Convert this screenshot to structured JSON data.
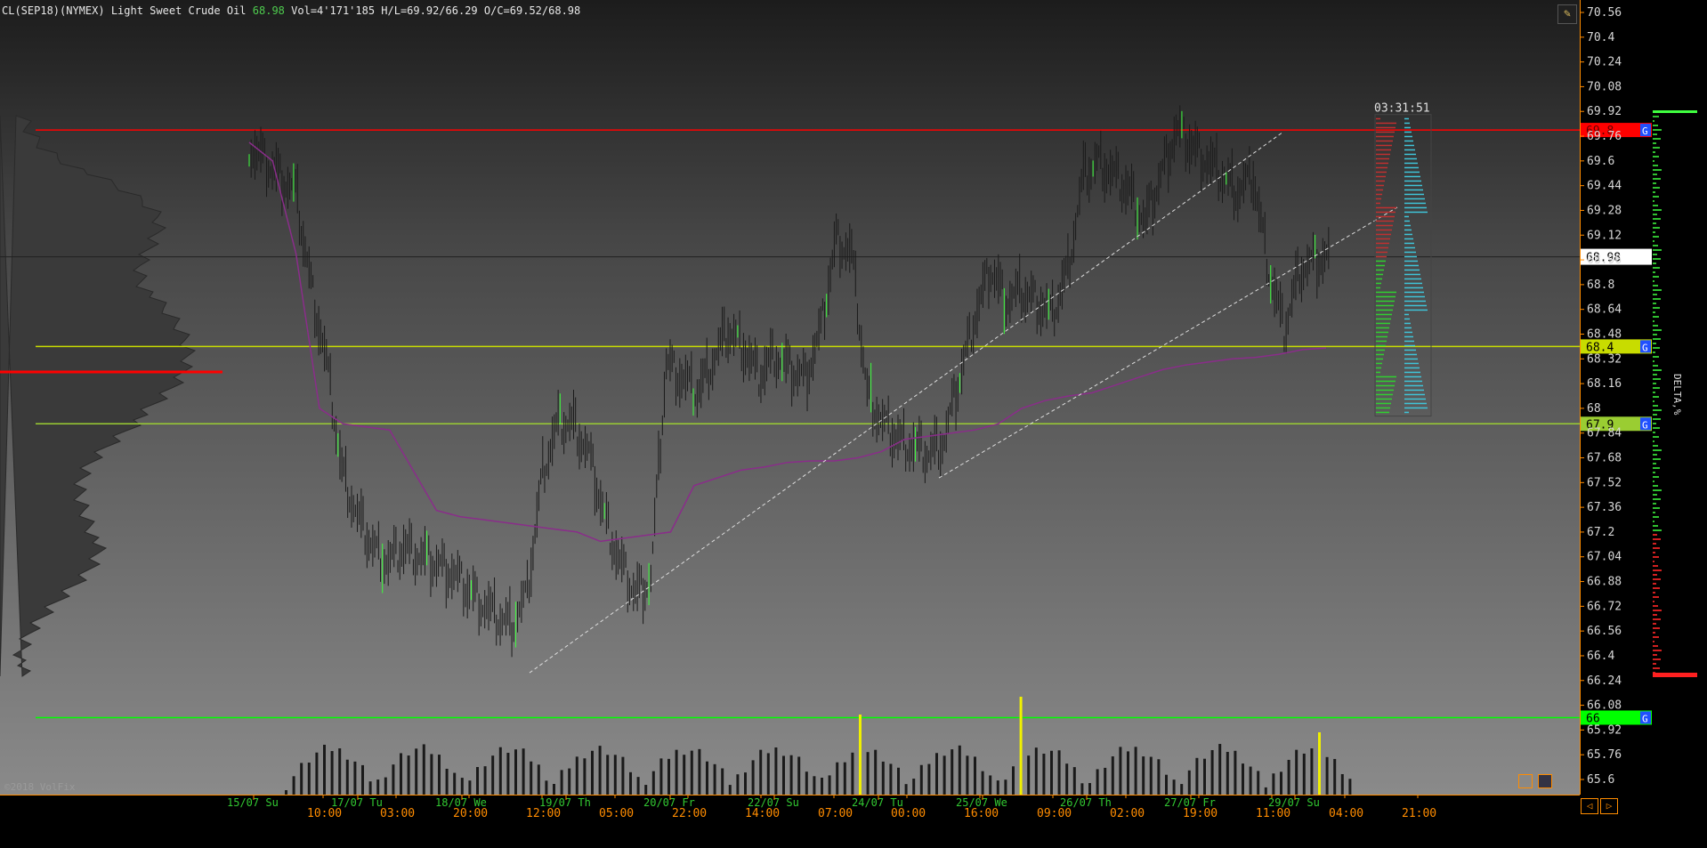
{
  "header": {
    "instrument": "CL(SEP18)(NYMEX) Light Sweet Crude Oil",
    "last": "68.98",
    "stats": "Vol=4'171'185 H/L=69.92/66.29 O/C=69.52/68.98"
  },
  "copyright": "©2018 VolFix",
  "timer": "03:31:51",
  "delta_label": "DELTA,%",
  "colors": {
    "vwap": "#8a2d8a",
    "resistance": "#ff0000",
    "support_yellow": "#c8dc00",
    "support_green": "#9acd32",
    "support_bright_green": "#00ff00",
    "last_price_bg": "#ffffff",
    "volume_spike": "#f0f000",
    "time_axis": "#ff8c00",
    "date_label": "#32c832"
  },
  "chart_data": {
    "type": "candlestick",
    "ylim": [
      65.5,
      70.6
    ],
    "price_ticks": [
      "70.56",
      "70.4",
      "70.24",
      "70.08",
      "69.92",
      "69.76",
      "69.6",
      "69.44",
      "69.28",
      "69.12",
      "68.96",
      "68.8",
      "68.64",
      "68.48",
      "68.32",
      "68.16",
      "68",
      "67.84",
      "67.68",
      "67.52",
      "67.36",
      "67.2",
      "67.04",
      "66.88",
      "66.72",
      "66.56",
      "66.4",
      "66.24",
      "66.08",
      "65.92",
      "65.76",
      "65.6"
    ],
    "last_price": 68.98,
    "levels": [
      {
        "price": 69.8,
        "label": "69.8",
        "color": "#ff0000"
      },
      {
        "price": 68.4,
        "label": "68.4",
        "color": "#c8dc00"
      },
      {
        "price": 67.9,
        "label": "67.9",
        "color": "#9acd32"
      },
      {
        "price": 66.0,
        "label": "66",
        "color": "#00ff00"
      }
    ],
    "date_labels": [
      "15/07 Su",
      "17/07 Tu",
      "18/07 We",
      "19/07 Th",
      "20/07 Fr",
      "22/07 Su",
      "24/07 Tu",
      "25/07 We",
      "26/07 Th",
      "27/07 Fr",
      "29/07 Su"
    ],
    "time_labels": [
      "10:00",
      "03:00",
      "20:00",
      "12:00",
      "05:00",
      "22:00",
      "14:00",
      "07:00",
      "00:00",
      "16:00",
      "09:00",
      "02:00",
      "19:00",
      "11:00",
      "04:00",
      "21:00"
    ],
    "close_path": [
      69.7,
      69.6,
      69.5,
      69.4,
      68.8,
      68.3,
      67.6,
      67.3,
      67.1,
      67.0,
      67.1,
      67.05,
      67.0,
      66.95,
      66.85,
      66.75,
      66.65,
      66.6,
      66.8,
      67.6,
      67.9,
      67.9,
      67.7,
      67.3,
      67.0,
      66.8,
      66.9,
      68.3,
      68.2,
      68.1,
      68.3,
      68.5,
      68.4,
      68.2,
      68.35,
      68.25,
      68.2,
      68.5,
      69.1,
      69.0,
      68.1,
      67.9,
      67.8,
      67.75,
      67.7,
      67.8,
      68.2,
      68.6,
      68.9,
      68.7,
      68.75,
      68.7,
      68.6,
      68.9,
      69.5,
      69.6,
      69.5,
      69.4,
      69.2,
      69.5,
      69.8,
      69.7,
      69.6,
      69.5,
      69.4,
      69.5,
      68.9,
      68.5,
      68.9,
      68.95,
      68.98
    ],
    "vwap_path": [
      69.72,
      69.6,
      69.0,
      68.0,
      67.9,
      67.88,
      67.86,
      67.6,
      67.34,
      67.3,
      67.28,
      67.26,
      67.24,
      67.22,
      67.2,
      67.14,
      67.16,
      67.18,
      67.2,
      67.5,
      67.55,
      67.6,
      67.62,
      67.65,
      67.66,
      67.66,
      67.68,
      67.72,
      67.8,
      67.82,
      67.84,
      67.86,
      67.9,
      68.0,
      68.05,
      68.08,
      68.1,
      68.15,
      68.2,
      68.25,
      68.28,
      68.3,
      68.32,
      68.33,
      68.35,
      68.38,
      68.39
    ],
    "volume_spikes_index": [
      25,
      32,
      45,
      53
    ]
  }
}
